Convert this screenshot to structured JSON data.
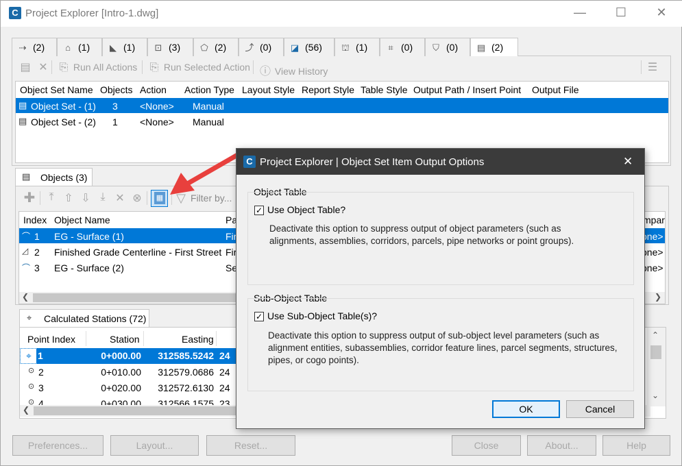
{
  "window": {
    "title": "Project Explorer [Intro-1.dwg]",
    "app_icon": "C",
    "minimize": "—",
    "maximize": "☐",
    "close": "✕"
  },
  "tabs": [
    {
      "icon": "alignment-icon",
      "glyph": "⇢",
      "label": "(2)"
    },
    {
      "icon": "profile-icon",
      "glyph": "⌂",
      "label": "(1)"
    },
    {
      "icon": "corridor-icon",
      "glyph": "◣",
      "label": "(1)"
    },
    {
      "icon": "assembly-icon",
      "glyph": "⊡",
      "label": "(3)"
    },
    {
      "icon": "surface-icon",
      "glyph": "⬠",
      "label": "(2)"
    },
    {
      "icon": "feature-line-icon",
      "glyph": "⤴",
      "label": "(0)"
    },
    {
      "icon": "parcel-icon",
      "glyph": "◪",
      "label": "(56)"
    },
    {
      "icon": "pipe-network-icon",
      "glyph": "⛫",
      "label": "(1)"
    },
    {
      "icon": "point-group-icon",
      "glyph": "⌗",
      "label": "(0)"
    },
    {
      "icon": "sample-line-icon",
      "glyph": "⛉",
      "label": "(0)"
    },
    {
      "icon": "object-set-icon",
      "glyph": "▤",
      "label": "(2)"
    }
  ],
  "toolbar": {
    "run_all": "Run All Actions",
    "run_selected": "Run Selected Action",
    "view_history": "View History"
  },
  "object_sets": {
    "columns": [
      "Object Set Name",
      "Objects",
      "Action",
      "Action Type",
      "Layout Style",
      "Report Style",
      "Table Style",
      "Output Path / Insert Point",
      "Output File"
    ],
    "rows": [
      {
        "name": "Object Set - (1)",
        "objects": "3",
        "action": "<None>",
        "type": "Manual"
      },
      {
        "name": "Object Set - (2)",
        "objects": "1",
        "action": "<None>",
        "type": "Manual"
      }
    ]
  },
  "objects_tab": {
    "label": "Objects (3)",
    "filter_placeholder": "Filter by..."
  },
  "objects": {
    "columns": [
      "Index",
      "Object Name",
      "Pa",
      "mpar"
    ],
    "rows": [
      {
        "index": "1",
        "name": "EG - Surface (1)",
        "pa": "Firs",
        "cmp": "one>"
      },
      {
        "index": "2",
        "name": "Finished Grade Centerline - First Street",
        "pa": "Firs",
        "cmp": "one>"
      },
      {
        "index": "3",
        "name": "EG - Surface (2)",
        "pa": "Sec",
        "cmp": "one>"
      }
    ]
  },
  "stations_tab": {
    "label": "Calculated Stations (72)"
  },
  "stations": {
    "columns": [
      "Point Index",
      "Station",
      "Easting"
    ],
    "rows": [
      {
        "index": "1",
        "station": "0+000.00",
        "easting": "312585.5242",
        "n": "24"
      },
      {
        "index": "2",
        "station": "0+010.00",
        "easting": "312579.0686",
        "n": "24"
      },
      {
        "index": "3",
        "station": "0+020.00",
        "easting": "312572.6130",
        "n": "24"
      },
      {
        "index": "4",
        "station": "0+030.00",
        "easting": "312566.1575",
        "n": "23"
      }
    ]
  },
  "bottom_buttons": [
    "Preferences...",
    "Layout...",
    "Reset...",
    "Close",
    "About...",
    "Help"
  ],
  "dialog": {
    "title": "Project Explorer | Object Set Item Output Options",
    "close": "✕",
    "group1": {
      "title": "Object Table",
      "checkbox_label": "Use Object Table?",
      "checked": true,
      "description": "Deactivate this option to suppress output of object parameters (such as alignments, assemblies, corridors, parcels, pipe networks or point groups)."
    },
    "group2": {
      "title": "Sub-Object Table",
      "checkbox_label": "Use Sub-Object Table(s)?",
      "checked": true,
      "description": "Deactivate this option to suppress output of sub-object level parameters (such as alignment entities, subassemblies, corridor feature lines, parcel segments, structures, pipes, or cogo points)."
    },
    "ok": "OK",
    "cancel": "Cancel"
  },
  "colors": {
    "selection": "#0078d7",
    "arrow": "#e8403d",
    "dialog_title_bg": "#3b3b3b"
  }
}
